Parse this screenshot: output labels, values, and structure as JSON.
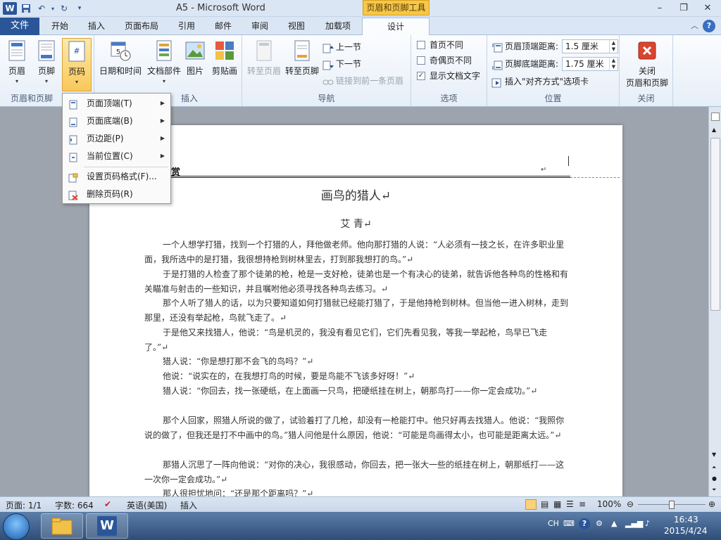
{
  "title_bar": {
    "app_title": "A5 - Microsoft Word",
    "context_tab": "页眉和页脚工具"
  },
  "tabs": {
    "file": "文件",
    "items": [
      "开始",
      "插入",
      "页面布局",
      "引用",
      "邮件",
      "审阅",
      "视图",
      "加载项",
      "设计"
    ]
  },
  "ribbon": {
    "header_footer_group": {
      "label": "页眉和页脚",
      "header": "页眉",
      "footer": "页脚",
      "page_number": "页码"
    },
    "insert_group": {
      "label": "插入",
      "date_time": "日期和时间",
      "doc_parts": "文档部件",
      "picture": "图片",
      "clipart": "剪贴画"
    },
    "nav_group": {
      "label": "导航",
      "goto_header": "转至页眉",
      "goto_footer": "转至页脚",
      "prev_section": "上一节",
      "next_section": "下一节",
      "link_previous": "链接到前一条页眉"
    },
    "options_group": {
      "label": "选项",
      "first_page": "首页不同",
      "odd_even": "奇偶页不同",
      "show_text": "显示文档文字"
    },
    "position_group": {
      "label": "位置",
      "header_dist_label": "页眉顶端距离:",
      "header_dist_value": "1.5 厘米",
      "footer_dist_label": "页脚底端距离:",
      "footer_dist_value": "1.75 厘米",
      "insert_align_tab": "插入\"对齐方式\"选项卡"
    },
    "close_group": {
      "label": "关闭",
      "close_line1": "关闭",
      "close_line2": "页眉和页脚"
    }
  },
  "menu": {
    "items": [
      {
        "label": "页面顶端(T)"
      },
      {
        "label": "页面底端(B)"
      },
      {
        "label": "页边距(P)"
      },
      {
        "label": "当前位置(C)"
      },
      {
        "label": "设置页码格式(F)..."
      },
      {
        "label": "删除页码(R)"
      }
    ]
  },
  "document": {
    "header_text": "赏",
    "title": "画鸟的猎人↵",
    "author": "艾  青↵",
    "paragraphs": [
      "一个人想学打猎，找到一个打猎的人，拜他做老师。他向那打猎的人说：“人必须有一技之长，在许多职业里面，我所选中的是打猎，我很想持枪到树林里去，打到那我想打的鸟。”↵",
      "于是打猎的人检查了那个徒弟的枪，枪是一支好枪，徒弟也是一个有决心的徒弟，就告诉他各种鸟的性格和有关瞄准与射击的一些知识，并且嘱咐他必须寻找各种鸟去练习。↵",
      "那个人听了猎人的话，以为只要知道如何打猎就已经能打猎了，于是他持枪到树林。但当他一进入树林，走到那里，还没有举起枪，鸟就飞走了。↵",
      "于是他又来找猎人，他说：“鸟是机灵的，我没有看见它们，它们先看见我，等我一举起枪，鸟早已飞走了。”↵",
      "猎人说：“你是想打那不会飞的鸟吗？”↵",
      "他说：“说实在的，在我想打鸟的时候，要是鸟能不飞该多好呀！”↵",
      "猎人说：“你回去，找一张硬纸，在上面画一只鸟，把硬纸挂在树上，朝那鸟打——你一定会成功。”↵",
      "那个人回家，照猎人所说的做了，试验着打了几枪，却没有一枪能打中。他只好再去找猎人。他说：“我照你说的做了，但我还是打不中画中的鸟。”猎人问他是什么原因，他说：“可能是鸟画得太小，也可能是距离太远。”↵",
      "那猎人沉思了一阵向他说：“对你的决心，我很感动，你回去，把一张大一些的纸挂在树上，朝那纸打——这一次你一定会成功。”↵",
      "那人很担忧地问：“还是那个距离吗？”↵"
    ]
  },
  "status_bar": {
    "page": "页面: 1/1",
    "words": "字数: 664",
    "language": "英语(美国)",
    "mode": "插入",
    "zoom": "100%"
  },
  "taskbar": {
    "lang": "CH",
    "time": "16:43",
    "date": "2015/4/24"
  },
  "colors": {
    "file_tab": "#2a5699",
    "context_tab": "#f5c74a",
    "active_button": "#f9c85a"
  }
}
